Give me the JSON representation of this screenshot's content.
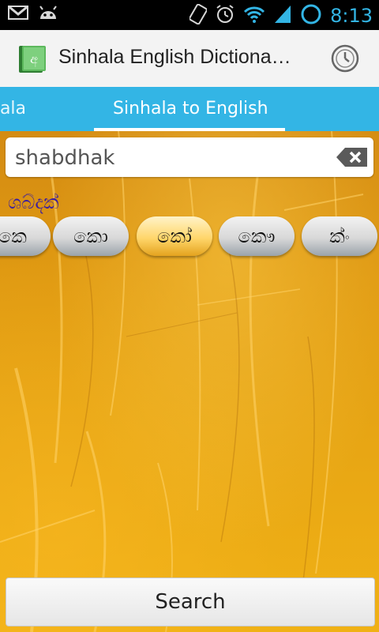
{
  "status_bar": {
    "time": "8:13",
    "colors": {
      "time": "#33b5e5"
    },
    "left_icons": [
      "gmail-icon",
      "android-debug-icon"
    ],
    "right_icons": [
      "rotate-lock-icon",
      "alarm-icon",
      "wifi-icon",
      "signal-icon",
      "sync-icon"
    ]
  },
  "action_bar": {
    "title": "Sinhala English Dictiona…",
    "app_icon_glyph": "අ",
    "history_icon": "clock-icon"
  },
  "tabs": {
    "left_partial_label": "hala",
    "active_label": "Sinhala to English",
    "accent": "#33b5e5"
  },
  "search": {
    "value": "shabdhak",
    "clear_icon": "backspace-clear-icon"
  },
  "transliteration": "ශබ්දක්",
  "suggestions": [
    {
      "label": "කෙ",
      "active": false
    },
    {
      "label": "කො",
      "active": false
    },
    {
      "label": "කෝ",
      "active": true
    },
    {
      "label": "කෞ",
      "active": false
    },
    {
      "label": "ක්ං",
      "active": false
    }
  ],
  "search_button": {
    "label": "Search"
  }
}
